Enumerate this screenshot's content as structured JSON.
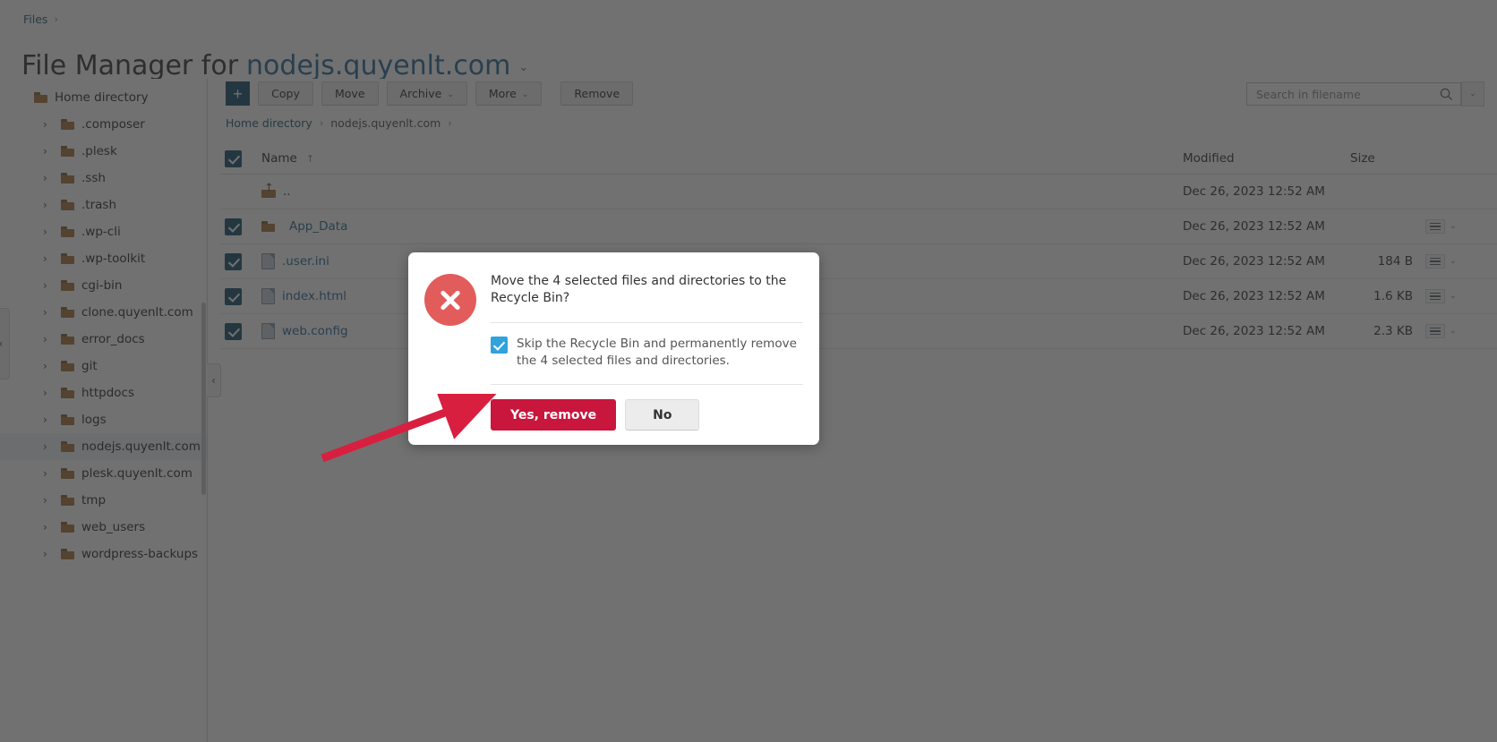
{
  "breadcrumb_top": {
    "root_label": "Files",
    "separator": "›"
  },
  "header": {
    "title_prefix": "File Manager for",
    "domain": "nodejs.quyenlt.com",
    "caret": "⌄"
  },
  "sidebar": {
    "collapse_outer_icon": "‹",
    "collapse_inner_icon": "‹",
    "root": {
      "label": "Home directory"
    },
    "items": [
      {
        "label": ".composer",
        "twisty": "›",
        "selected": false
      },
      {
        "label": ".plesk",
        "twisty": "›",
        "selected": false
      },
      {
        "label": ".ssh",
        "twisty": "›",
        "selected": false
      },
      {
        "label": ".trash",
        "twisty": "›",
        "selected": false
      },
      {
        "label": ".wp-cli",
        "twisty": "›",
        "selected": false
      },
      {
        "label": ".wp-toolkit",
        "twisty": "›",
        "selected": false
      },
      {
        "label": "cgi-bin",
        "twisty": "›",
        "selected": false
      },
      {
        "label": "clone.quyenlt.com",
        "twisty": "›",
        "selected": false
      },
      {
        "label": "error_docs",
        "twisty": "›",
        "selected": false
      },
      {
        "label": "git",
        "twisty": "›",
        "selected": false
      },
      {
        "label": "httpdocs",
        "twisty": "›",
        "selected": false
      },
      {
        "label": "logs",
        "twisty": "›",
        "selected": false
      },
      {
        "label": "nodejs.quyenlt.com",
        "twisty": "›",
        "selected": true
      },
      {
        "label": "plesk.quyenlt.com",
        "twisty": "›",
        "selected": false
      },
      {
        "label": "tmp",
        "twisty": "›",
        "selected": false
      },
      {
        "label": "web_users",
        "twisty": "›",
        "selected": false
      },
      {
        "label": "wordpress-backups",
        "twisty": "›",
        "selected": false
      }
    ]
  },
  "toolbar": {
    "add_label": "+",
    "copy_label": "Copy",
    "move_label": "Move",
    "archive_label": "Archive",
    "archive_caret": "⌄",
    "more_label": "More",
    "more_caret": "⌄",
    "remove_label": "Remove"
  },
  "search": {
    "placeholder": "Search in filename",
    "value": "",
    "dropdown_caret": "⌄"
  },
  "path_breadcrumb": {
    "items": [
      "Home directory",
      "nodejs.quyenlt.com"
    ],
    "separator": "›",
    "trailing_separator": "›"
  },
  "table": {
    "columns": {
      "name": "Name",
      "modified": "Modified",
      "size": "Size"
    },
    "sort_indicator": "↑",
    "header_checkbox_checked": true,
    "rows": [
      {
        "name": "..",
        "icon": "parent-folder",
        "checked": null,
        "modified": "Dec 26, 2023 12:52 AM",
        "size": "",
        "has_actions": false
      },
      {
        "name": "App_Data",
        "icon": "folder",
        "checked": true,
        "modified": "Dec 26, 2023 12:52 AM",
        "size": "",
        "has_actions": true
      },
      {
        "name": ".user.ini",
        "icon": "file",
        "checked": true,
        "modified": "Dec 26, 2023 12:52 AM",
        "size": "184 B",
        "has_actions": true
      },
      {
        "name": "index.html",
        "icon": "file",
        "checked": true,
        "modified": "Dec 26, 2023 12:52 AM",
        "size": "1.6 KB",
        "has_actions": true
      },
      {
        "name": "web.config",
        "icon": "file",
        "checked": true,
        "modified": "Dec 26, 2023 12:52 AM",
        "size": "2.3 KB",
        "has_actions": true
      }
    ]
  },
  "dialog": {
    "icon": "error-circle-x",
    "message": "Move the 4 selected files and directories to the Recycle Bin?",
    "checkbox_label": "Skip the Recycle Bin and permanently remove the 4 selected files and directories.",
    "checkbox_checked": true,
    "confirm_label": "Yes, remove",
    "cancel_label": "No"
  },
  "annotation": {
    "type": "arrow",
    "color": "#d81f3f",
    "points_to": "Yes, remove"
  },
  "colors": {
    "accent_blue": "#1f5673",
    "link_blue": "#2c6e9b",
    "danger_red": "#c8163c",
    "error_icon_red": "#e25c5c",
    "checkbox_blue": "#30a2dc",
    "folder_brown": "#a97a42",
    "overlay": "#565656"
  }
}
